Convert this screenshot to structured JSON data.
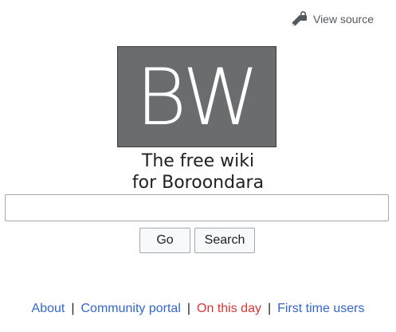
{
  "header": {
    "view_source_label": "View source",
    "view_source_icon": "lock-pencil-icon"
  },
  "logo": {
    "text": "BW",
    "background_color": "#6b6c6e"
  },
  "tagline": {
    "line1": "The free wiki",
    "line2": "for Boroondara"
  },
  "search": {
    "value": "",
    "go_label": "Go",
    "search_label": "Search"
  },
  "footer": {
    "separator": "|",
    "links": [
      {
        "label": "About",
        "color": "#3366cc"
      },
      {
        "label": "Community portal",
        "color": "#3366cc"
      },
      {
        "label": "On this day",
        "color": "#dd3333"
      },
      {
        "label": "First time users",
        "color": "#3366cc"
      }
    ]
  }
}
